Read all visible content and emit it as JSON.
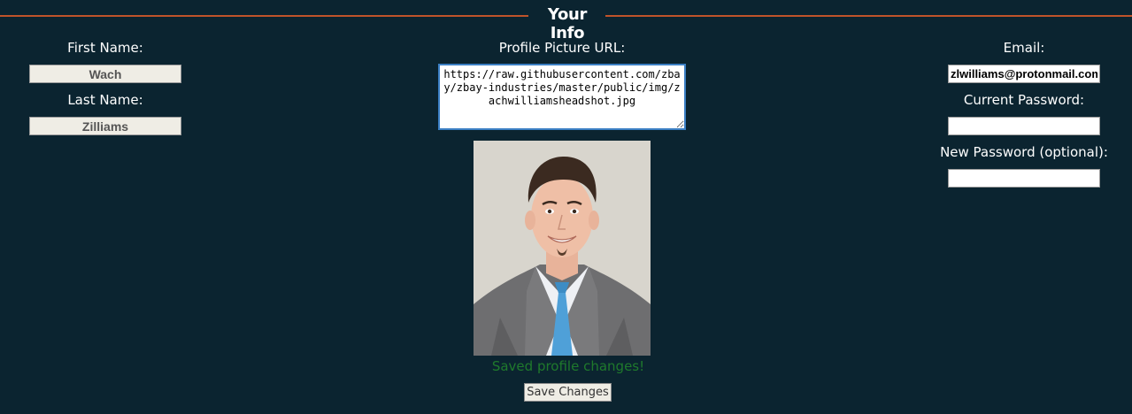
{
  "section": {
    "title": "Your Info"
  },
  "left": {
    "first_name_label": "First Name:",
    "first_name_value": "Wach",
    "last_name_label": "Last Name:",
    "last_name_value": "Zilliams"
  },
  "center": {
    "url_label": "Profile Picture URL:",
    "url_value": "https://raw.githubusercontent.com/zbay/zbay-industries/master/public/img/zachwilliamsheadshot.jpg",
    "status_text": "Saved profile changes!",
    "save_button_label": "Save Changes"
  },
  "right": {
    "email_label": "Email:",
    "email_value": "zlwilliams@protonmail.com",
    "current_password_label": "Current Password:",
    "current_password_value": "",
    "new_password_label": "New Password (optional):",
    "new_password_value": ""
  },
  "colors": {
    "background": "#0b2430",
    "rule": "#c0532a",
    "status": "#1f7a2c",
    "url_border": "#3b7fc4"
  }
}
